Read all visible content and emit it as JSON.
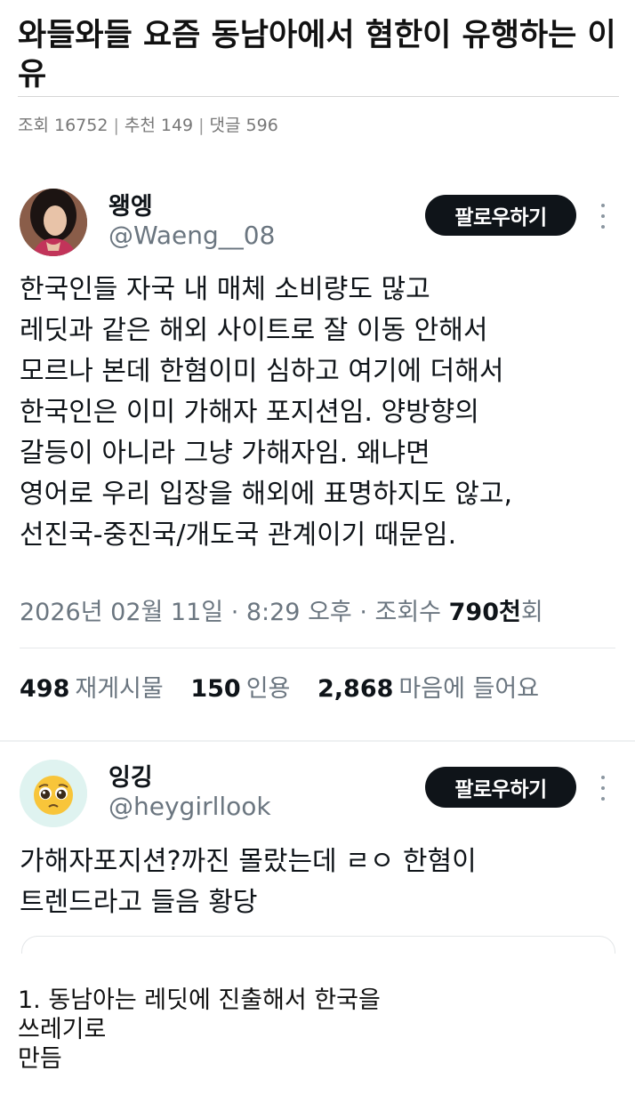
{
  "post": {
    "title": "와들와들 요즘 동남아에서 혐한이 유행하는 이유",
    "meta": {
      "views": "조회 16752",
      "recommend": "추천 149",
      "comments": "댓글 596",
      "separator": "|"
    }
  },
  "tweet1": {
    "display_name": "왱엥",
    "handle": "@Waeng__08",
    "follow_label": "팔로우하기",
    "body_lines": [
      "한국인들 자국 내 매체 소비량도 많고",
      "레딧과 같은 해외 사이트로 잘 이동 안해서",
      "모르나 본데 한혐이미 심하고 여기에 더해서",
      "한국인은 이미 가해자 포지션임. 양방향의",
      "갈등이 아니라 그냥 가해자임. 왜냐면",
      "영어로 우리 입장을 해외에 표명하지도 않고,",
      "선진국-중진국/개도국 관계이기 때문임."
    ],
    "timestamp": "2026년 02월 11일 · 8:29 오후 · 조회수",
    "view_count": "790천",
    "view_suffix": "회",
    "stats": {
      "retweets_count": "498",
      "retweets_label": "재게시물",
      "quotes_count": "150",
      "quotes_label": "인용",
      "likes_count": "2,868",
      "likes_label": "마음에 들어요"
    }
  },
  "tweet2": {
    "display_name": "잉깅",
    "handle": "@heygirllook",
    "follow_label": "팔로우하기",
    "body_lines": [
      "가해자포지션?까진 몰랐는데 ㄹㅇ 한혐이",
      "트렌드라고 들음 황당"
    ]
  },
  "caption": {
    "lines": [
      "1. 동남아는 레딧에 진출해서 한국을",
      "쓰레기로",
      "만듬"
    ]
  },
  "colors": {
    "follow_bg": "#0f1419",
    "secondary_text": "#6b7680",
    "avatar2_bg": "#dff3f0"
  },
  "icons": {
    "more": "more-vertical-icon",
    "avatar1": "profile-photo",
    "avatar2": "pleading-face-emoji"
  }
}
